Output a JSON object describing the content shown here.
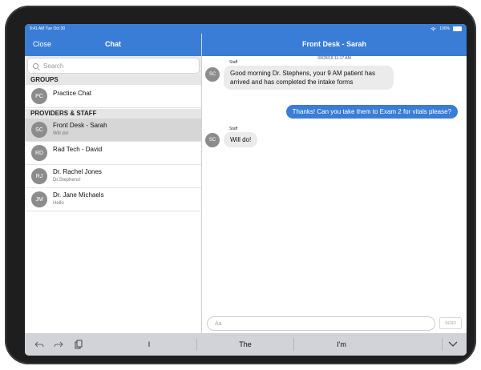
{
  "status_bar": {
    "time": "9:41 AM  Tue Oct 30",
    "battery": "100%"
  },
  "nav": {
    "close_label": "Close",
    "chat_title": "Chat",
    "conversation_title": "Front Desk - Sarah"
  },
  "search": {
    "placeholder": "Search"
  },
  "sections": {
    "groups": "GROUPS",
    "providers": "PROVIDERS & STAFF"
  },
  "groups": [
    {
      "initials": "PC",
      "name": "Practice Chat"
    }
  ],
  "providers": [
    {
      "initials": "SC",
      "name": "Front Desk - Sarah",
      "preview": "Will do!",
      "selected": true
    },
    {
      "initials": "RD",
      "name": "Rad Tech - David",
      "preview": ""
    },
    {
      "initials": "RJ",
      "name": "Dr. Rachel Jones",
      "preview": "Dr.Stephens!"
    },
    {
      "initials": "JM",
      "name": "Dr. Jane Michaels",
      "preview": "Hello"
    }
  ],
  "conversation": {
    "timestamp": "09/28/18 11:17 AM",
    "messages": [
      {
        "direction": "in",
        "sender_label": "Staff",
        "initials": "SC",
        "text": "Good morning Dr. Stephens, your 9 AM patient has arrived and has completed the intake forms"
      },
      {
        "direction": "out",
        "text": "Thanks! Can you take them to Exam 2 for vitals please?"
      },
      {
        "direction": "in",
        "sender_label": "Staff",
        "initials": "SC",
        "text": "Will do!"
      }
    ]
  },
  "composer": {
    "placeholder": "Aa",
    "send_label": "SEND"
  },
  "keyboard": {
    "suggestions": [
      "I",
      "The",
      "I'm"
    ]
  },
  "colors": {
    "accent": "#3a7dd6",
    "selected_row": "#d6d6d6",
    "bubble_in": "#ebebeb"
  },
  "icons": [
    "search-icon",
    "undo-icon",
    "redo-icon",
    "paste-icon",
    "chevron-down-icon",
    "wifi-icon",
    "battery-icon"
  ]
}
